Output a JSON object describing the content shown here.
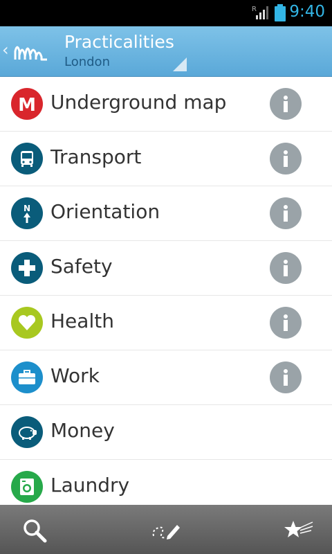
{
  "status_bar": {
    "clock": "9:40",
    "signal_label": "R"
  },
  "header": {
    "title": "Practicalities",
    "subtitle": "London"
  },
  "items": [
    {
      "label": "Underground map",
      "icon": "metro-m-icon",
      "color": "#d9262c",
      "has_info": true
    },
    {
      "label": "Transport",
      "icon": "bus-icon",
      "color": "#0a5c7a",
      "has_info": true
    },
    {
      "label": "Orientation",
      "icon": "compass-north-icon",
      "color": "#0a5c7a",
      "has_info": true
    },
    {
      "label": "Safety",
      "icon": "cross-icon",
      "color": "#0a5c7a",
      "has_info": true
    },
    {
      "label": "Health",
      "icon": "heart-icon",
      "color": "#a8c820",
      "has_info": true
    },
    {
      "label": "Work",
      "icon": "briefcase-icon",
      "color": "#1d8fcb",
      "has_info": true
    },
    {
      "label": "Money",
      "icon": "piggy-bank-icon",
      "color": "#0a5c7a",
      "has_info": false
    },
    {
      "label": "Laundry",
      "icon": "washing-machine-icon",
      "color": "#27a94a",
      "has_info": false
    }
  ],
  "bottom_bar": {
    "search": "search-icon",
    "route": "route-pen-icon",
    "favorites": "favorites-stars-icon"
  }
}
